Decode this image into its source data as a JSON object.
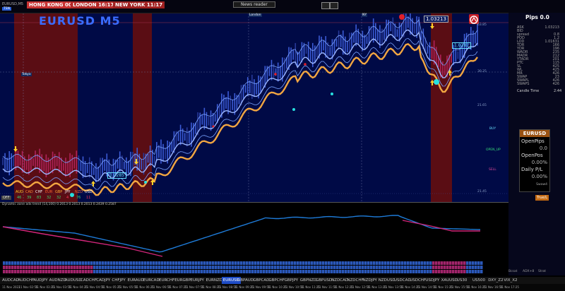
{
  "window": {
    "tab": "EURUSD,M5",
    "badge": "TSN"
  },
  "sessions": [
    {
      "label": "HONG KONG",
      "time": "00:17",
      "color": "#c83232"
    },
    {
      "label": "LONDON",
      "time": "16:17",
      "color": "#b42828"
    },
    {
      "label": "NEW YORK",
      "time": "11:17",
      "color": "#a02020"
    }
  ],
  "news_reader": "News reader",
  "chart": {
    "symbol_title": "EURUSD M5",
    "price_tags": [
      "1.03213",
      "1.0281",
      "1.0285"
    ],
    "session_markers": [
      "Tokyo",
      "London",
      "NY"
    ],
    "currency_strength": {
      "currencies": [
        "AUD",
        "CAD",
        "CHF",
        "EUR",
        "GBP",
        "JPY",
        "NZD",
        "USD"
      ],
      "values": [
        "46",
        "39",
        "83",
        "32",
        "32",
        "4",
        "76",
        "11"
      ]
    },
    "right_labels": {
      "buy": "BUY",
      "open_up": "OPEN_UP",
      "sell": "SELL"
    },
    "right_axis": [
      "63.85",
      "30.25",
      "21.65",
      "21.45"
    ],
    "off_badge": "OFF"
  },
  "panel": {
    "pips_title": "Pips 0.0",
    "rows": [
      {
        "k": "ASK",
        "v": "1.03213"
      },
      {
        "k": "BID",
        "v": ""
      },
      {
        "k": "spread",
        "v": "0.8"
      },
      {
        "k": "POD",
        "v": "1.2"
      },
      {
        "k": "LOD",
        "v": "1.01631"
      },
      {
        "k": "TDR",
        "v": "166"
      },
      {
        "k": "YDR",
        "v": "196"
      },
      {
        "k": "WADR",
        "v": "235"
      },
      {
        "k": "MADR",
        "v": "212"
      },
      {
        "k": "YTADR",
        "v": "201"
      },
      {
        "k": "PTC",
        "v": "115"
      },
      {
        "k": "SL",
        "v": "425"
      },
      {
        "k": "WL",
        "v": "425"
      },
      {
        "k": "MR",
        "v": "426"
      },
      {
        "k": "SWAP",
        "v": "23"
      },
      {
        "k": "SWAPL",
        "v": "426"
      },
      {
        "k": "SWAPS",
        "v": "426"
      }
    ],
    "candle_time": {
      "label": "Candle Time",
      "value": "2:44"
    },
    "account": {
      "symbol": "EURUSD",
      "open_pips_label": "OpenPips",
      "open_pips": "0.0",
      "open_pos_label": "OpenPos",
      "open_pos": "0.00%",
      "daily_pl_label": "Daily P/L",
      "daily_pl": "0.00%",
      "footer": "Swaw4",
      "button": "True/L"
    }
  },
  "oscillator": {
    "label": "Dynamic zone adx trend (14,100) 0.2013 0.2013 0.2013 0.2439 0.2587"
  },
  "strip_labels": [
    "Bcsat",
    "ADX+8",
    "Strat"
  ],
  "symbols": [
    "AUDCAD",
    "AUDCHF",
    "AUDJPY",
    "AUDNZD",
    "AUDUSD",
    "CADCHF",
    "CADJPY",
    "CHFJPY",
    "EURAUD",
    "EURCAD",
    "EURCHF",
    "EURGBP",
    "EURJPY",
    "EURNZD",
    "EURUSD",
    "GBPAUD",
    "GBPCAD",
    "GBPCHF",
    "GBPJPY",
    "GBPNZD",
    "GBPUSD",
    "NZDCAD",
    "NZDCHF",
    "NZDJPY",
    "NZDUSD",
    "USDCAD",
    "USDCHF",
    "USDJPY",
    "XAUUSD",
    "US30",
    "US500",
    "DXY_Z2",
    "VIX_X2"
  ],
  "active_symbol": "EURUSD",
  "dates": [
    "11 Nov 2022",
    "11 Nov 02:55",
    "11 Nov 03:25",
    "11 Nov 03:55",
    "11 Nov 04:25",
    "11 Nov 04:55",
    "11 Nov 05:25",
    "11 Nov 05:55",
    "11 Nov 06:25",
    "11 Nov 06:55",
    "11 Nov 07:25",
    "11 Nov 07:55",
    "11 Nov 08:25",
    "11 Nov 08:55",
    "11 Nov 09:25",
    "11 Nov 09:55",
    "11 Nov 10:25",
    "11 Nov 10:55",
    "11 Nov 11:25",
    "11 Nov 11:55",
    "11 Nov 12:25",
    "11 Nov 12:55",
    "11 Nov 13:25",
    "11 Nov 13:55",
    "11 Nov 14:25",
    "11 Nov 14:55",
    "11 Nov 15:25",
    "11 Nov 15:55",
    "11 Nov 16:25",
    "11 Nov 16:55",
    "11 Nov 17:25"
  ],
  "colors": {
    "bull": "#3b5bd6",
    "bear": "#b0225a",
    "ma": "#f2a641",
    "bands": "#7aa2ff",
    "highlight": "#5a0d14",
    "osc": "#1e7bd8",
    "osc_neg": "#d2267a"
  }
}
